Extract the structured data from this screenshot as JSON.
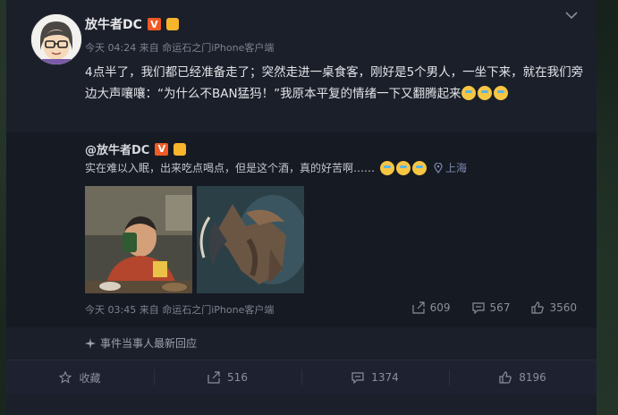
{
  "post": {
    "author": "放牛者DC",
    "meta": "今天 04:24 来自",
    "source": "命运石之门iPhone客户端",
    "text": "4点半了，我们都已经准备走了；突然走进一桌食客，刚好是5个男人，一坐下来，就在我们旁边大声嚷嚷：“为什么不BAN猛犸！”我原本平复的情绪一下又翻腾起来"
  },
  "repost": {
    "author": "@放牛者DC",
    "text": "实在难以入眠，出来吃点喝点，但是这个酒，真的好苦啊……",
    "location": "上海",
    "meta": "今天 03:45 来自",
    "source": "命运石之门iPhone客户端",
    "actions": {
      "repost": "609",
      "comment": "567",
      "like": "3560"
    }
  },
  "event_link": "事件当事人最新回应",
  "footer": {
    "favorite": "收藏",
    "repost": "516",
    "comment": "1374",
    "like": "8196"
  },
  "badges": {
    "v": "V"
  }
}
